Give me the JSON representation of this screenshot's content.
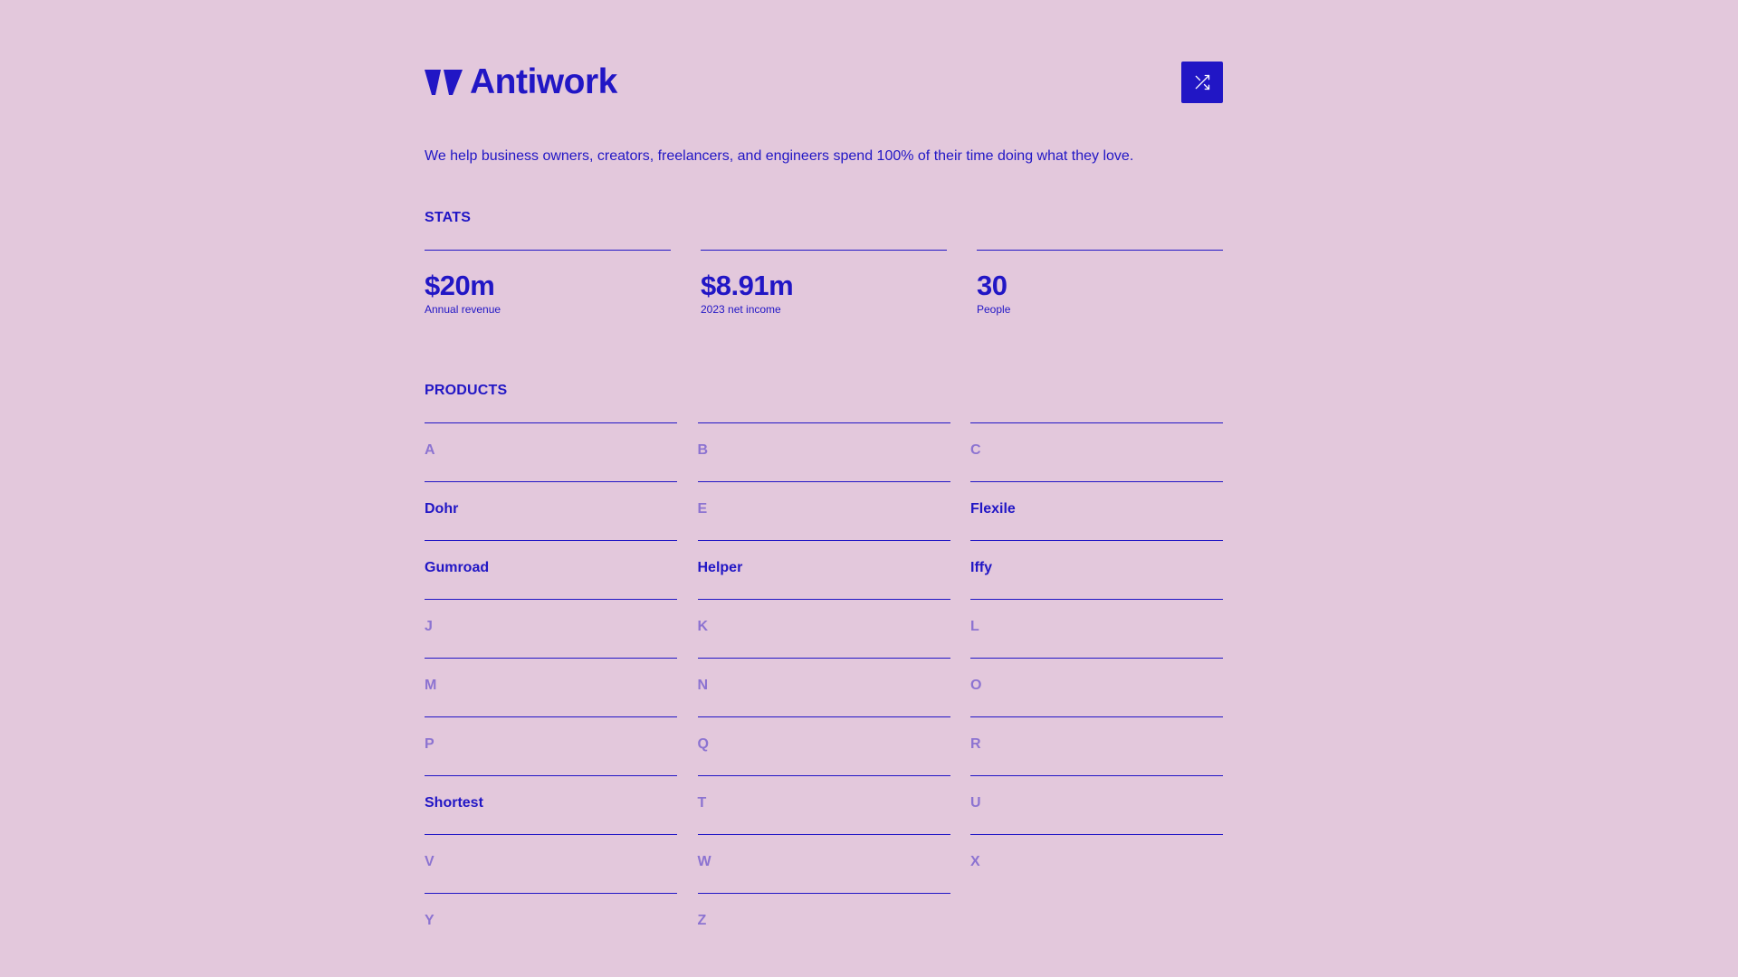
{
  "brand": {
    "name": "Antiwork",
    "logo_icon": "antiwork-logo-icon"
  },
  "header": {
    "shuffle_icon": "shuffle-icon"
  },
  "tagline": "We help business owners, creators, freelancers, and engineers spend 100% of their time doing what they love.",
  "stats": {
    "title": "STATS",
    "items": [
      {
        "value": "$20m",
        "label": "Annual revenue"
      },
      {
        "value": "$8.91m",
        "label": "2023 net income"
      },
      {
        "value": "30",
        "label": "People"
      }
    ]
  },
  "products": {
    "title": "PRODUCTS",
    "items": [
      {
        "label": "A",
        "active": false
      },
      {
        "label": "B",
        "active": false
      },
      {
        "label": "C",
        "active": false
      },
      {
        "label": "Dohr",
        "active": true
      },
      {
        "label": "E",
        "active": false
      },
      {
        "label": "Flexile",
        "active": true
      },
      {
        "label": "Gumroad",
        "active": true
      },
      {
        "label": "Helper",
        "active": true
      },
      {
        "label": "Iffy",
        "active": true
      },
      {
        "label": "J",
        "active": false
      },
      {
        "label": "K",
        "active": false
      },
      {
        "label": "L",
        "active": false
      },
      {
        "label": "M",
        "active": false
      },
      {
        "label": "N",
        "active": false
      },
      {
        "label": "O",
        "active": false
      },
      {
        "label": "P",
        "active": false
      },
      {
        "label": "Q",
        "active": false
      },
      {
        "label": "R",
        "active": false
      },
      {
        "label": "Shortest",
        "active": true
      },
      {
        "label": "T",
        "active": false
      },
      {
        "label": "U",
        "active": false
      },
      {
        "label": "V",
        "active": false
      },
      {
        "label": "W",
        "active": false
      },
      {
        "label": "X",
        "active": false
      },
      {
        "label": "Y",
        "active": false
      },
      {
        "label": "Z",
        "active": false
      }
    ]
  },
  "colors": {
    "background": "#e3c8dc",
    "accent": "#2116c5",
    "muted": "#8c73d1"
  }
}
